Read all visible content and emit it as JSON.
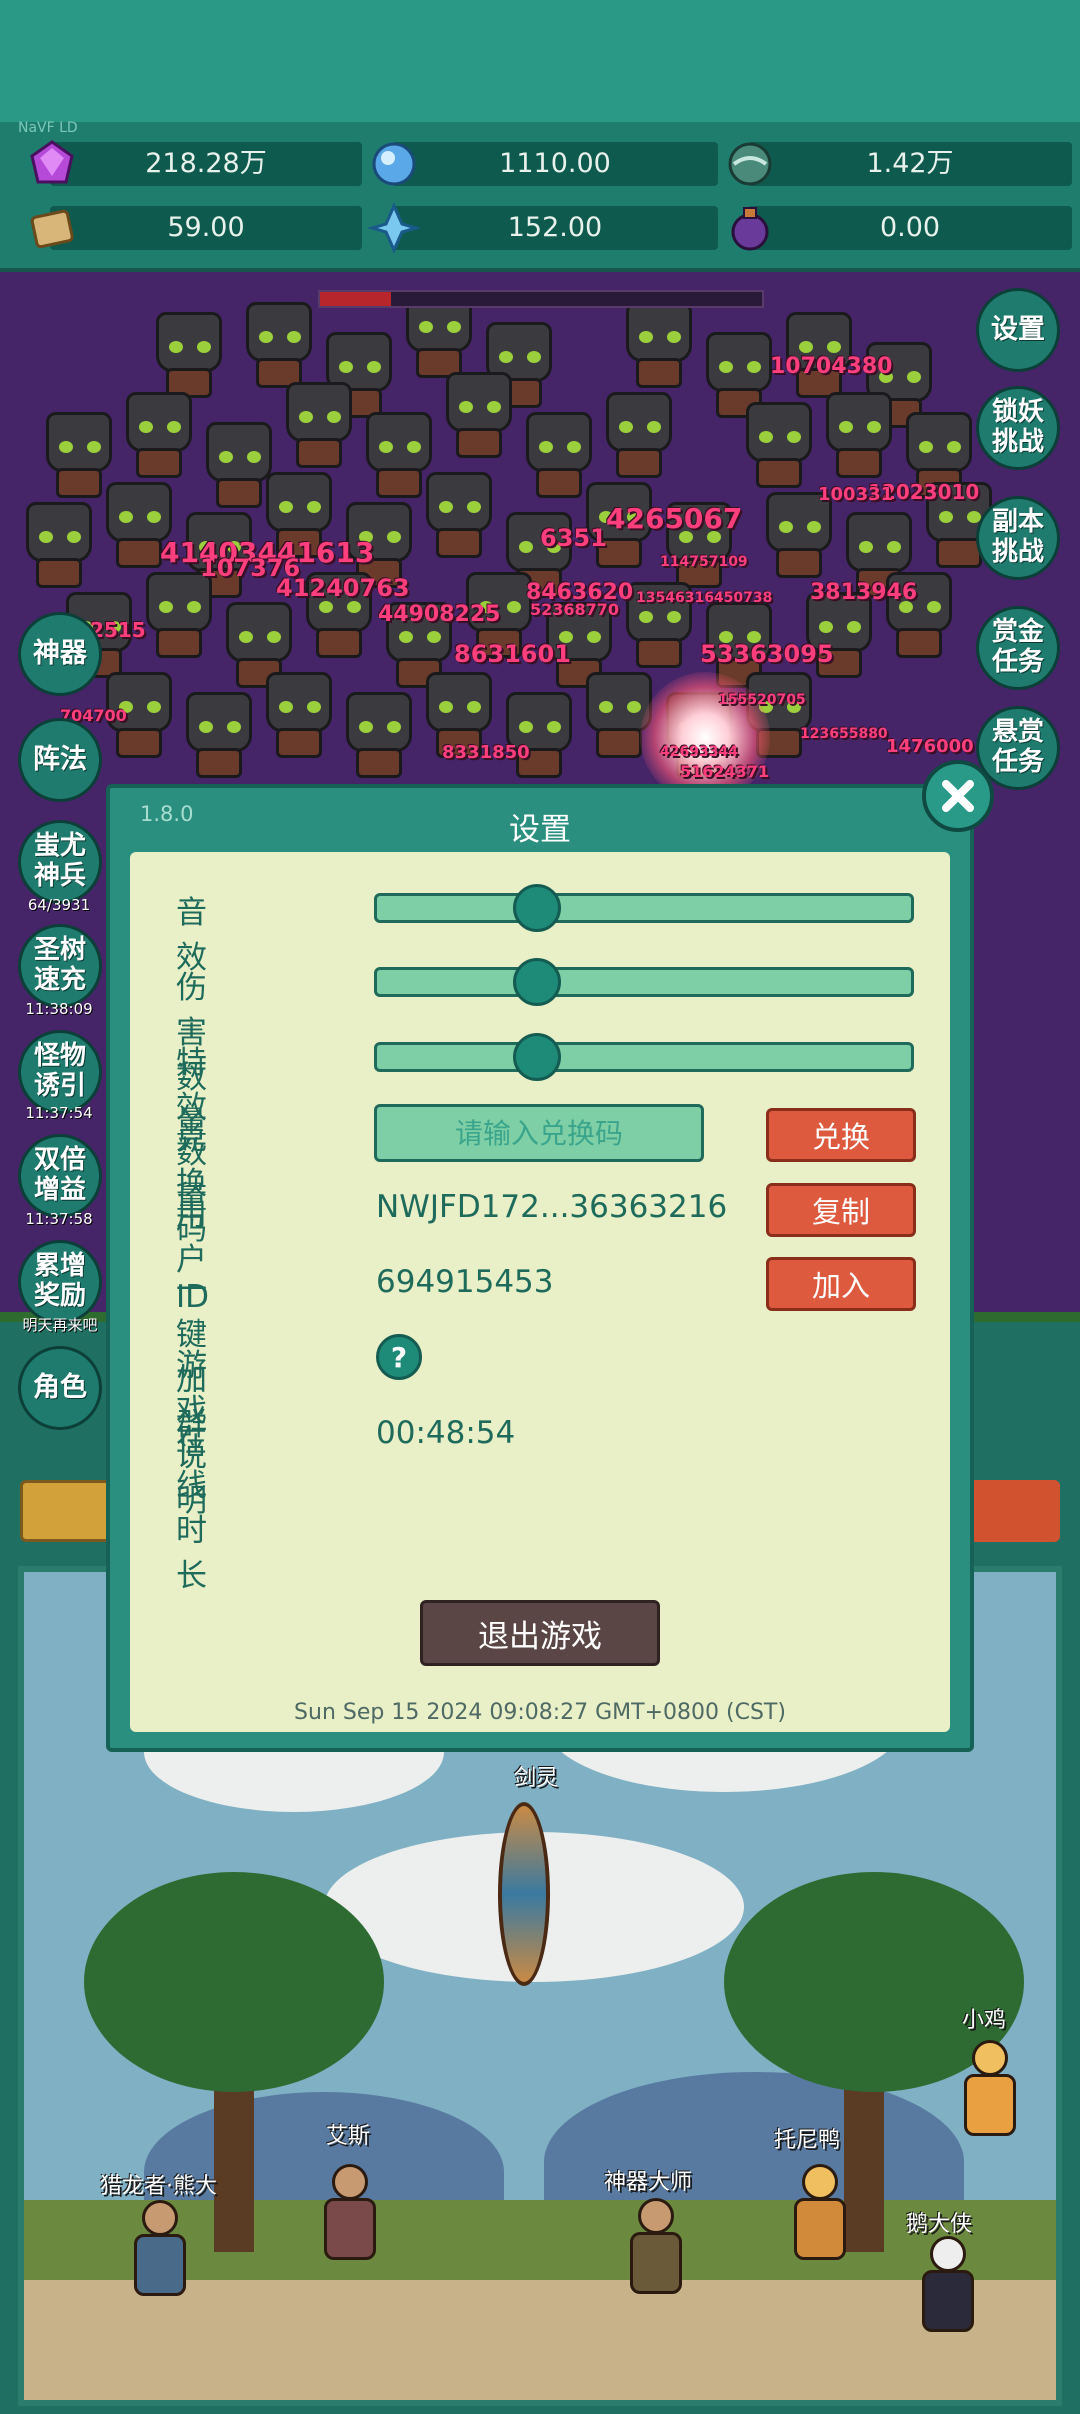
{
  "resources": {
    "small_label": "NaVF LD",
    "items": [
      {
        "icon": "purple-gem-icon",
        "value": "218.28万"
      },
      {
        "icon": "blue-crystal-icon",
        "value": "1110.00"
      },
      {
        "icon": "teal-orb-icon",
        "value": "1.42万"
      },
      {
        "icon": "scroll-icon",
        "value": "59.00"
      },
      {
        "icon": "ice-shard-icon",
        "value": "152.00"
      },
      {
        "icon": "purple-potion-icon",
        "value": "0.00"
      }
    ]
  },
  "boss_hp_fraction": 0.16,
  "damage_numbers": [
    "10704380",
    "41403441613",
    "107376",
    "41240763",
    "4265067",
    "6351",
    "52368770",
    "8463620",
    "3813946",
    "44908225",
    "8631601",
    "53363095",
    "12023010",
    "100331",
    "8331850",
    "1476000",
    "2515",
    "114757109",
    "13546316450738",
    "155520705",
    "123655880",
    "42693344",
    "51624371",
    "704700"
  ],
  "right_menu": [
    {
      "label": "设置"
    },
    {
      "label": "锁妖挑战"
    },
    {
      "label": "副本挑战"
    },
    {
      "label": "赏金任务"
    },
    {
      "label": "悬赏任务"
    }
  ],
  "left_menu": [
    {
      "label": "神器",
      "timer": ""
    },
    {
      "label": "阵法",
      "timer": ""
    },
    {
      "label": "蚩尤神兵",
      "timer": "64/3931"
    },
    {
      "label": "圣树速充",
      "timer": "11:38:09"
    },
    {
      "label": "怪物诱引",
      "timer": "11:37:54"
    },
    {
      "label": "双倍增益",
      "timer": "11:37:58"
    },
    {
      "label": "累增奖励",
      "timer": "明天再来吧"
    },
    {
      "label": "角色",
      "timer": ""
    }
  ],
  "scene": {
    "center_label": "剑灵",
    "characters": [
      "猎龙者·熊大",
      "艾斯",
      "神器大师",
      "托尼鸭",
      "鹅大侠",
      "小鸡"
    ]
  },
  "dialog": {
    "version": "1.8.0",
    "title": "设置",
    "sound_label": "音效",
    "sound_value": 0.3,
    "damage_count_label": "伤害数量",
    "damage_count_value": 0.3,
    "effects_label": "特效数量",
    "effects_value": 0.3,
    "redeem_label": "兑换码",
    "redeem_placeholder": "请输入兑换码",
    "redeem_button": "兑换",
    "userid_label": "用户ID",
    "userid_value": "NWJFD172...36363216",
    "copy_button": "复制",
    "group_label": "一键加群",
    "group_value": "694915453",
    "join_button": "加入",
    "guide_label": "游戏说明",
    "guide_button": "?",
    "online_label": "在线时长",
    "online_value": "00:48:54",
    "exit_button": "退出游戏",
    "datetime": "Sun Sep 15 2024 09:08:27 GMT+0800 (CST)"
  },
  "colors": {
    "panel": "#2b8f7f",
    "panel_body": "#e9efc6",
    "accent_text": "#1e6b5c",
    "action_red": "#de5a3e",
    "slider_fill": "#7fcfa6",
    "damage": "#ff3e7e"
  }
}
